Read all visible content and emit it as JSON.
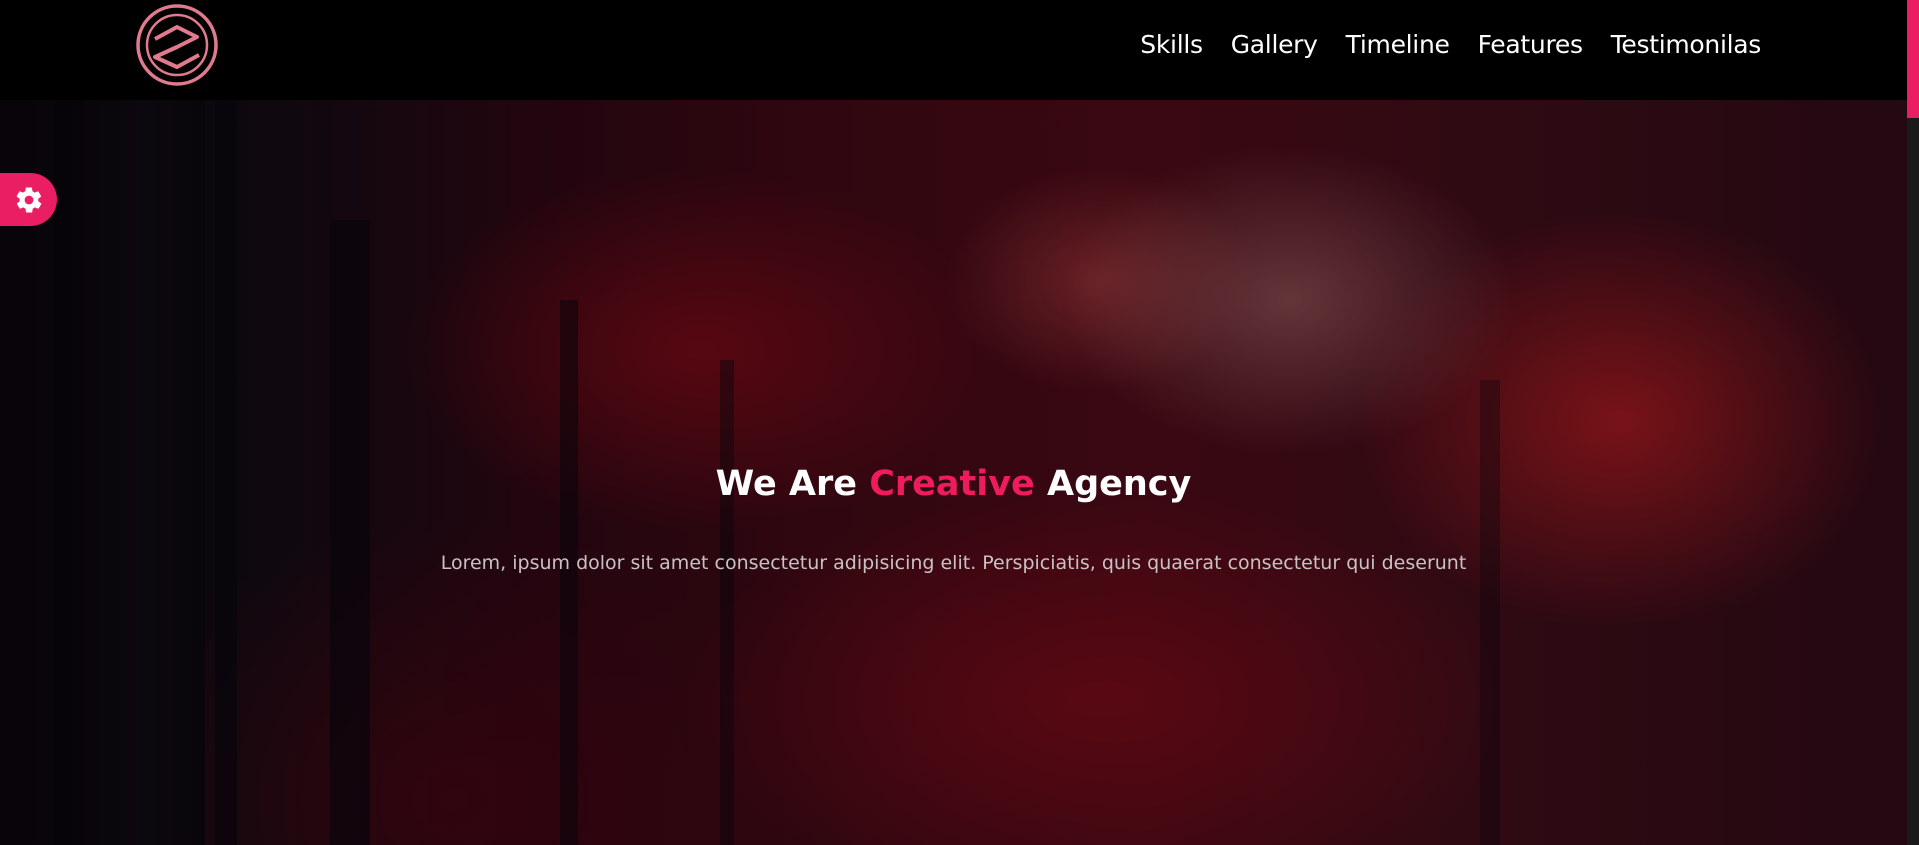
{
  "header": {
    "logo_icon": "circular-s-logo-icon",
    "nav": [
      {
        "label": "Skills"
      },
      {
        "label": "Gallery"
      },
      {
        "label": "Timeline"
      },
      {
        "label": "Features"
      },
      {
        "label": "Testimonilas"
      }
    ]
  },
  "hero": {
    "title_start": "We Are",
    "title_accent": "Creative",
    "title_end": "Agency",
    "text": "Lorem, ipsum dolor sit amet consectetur adipisicing elit. Perspiciatis, quis quaerat consectetur qui deserunt"
  },
  "settings": {
    "icon": "gear-icon"
  },
  "colors": {
    "accent": "#e91e63",
    "title_accent": "#ee1c5b",
    "header_bg": "#000000",
    "nav_text": "#ffffff"
  }
}
